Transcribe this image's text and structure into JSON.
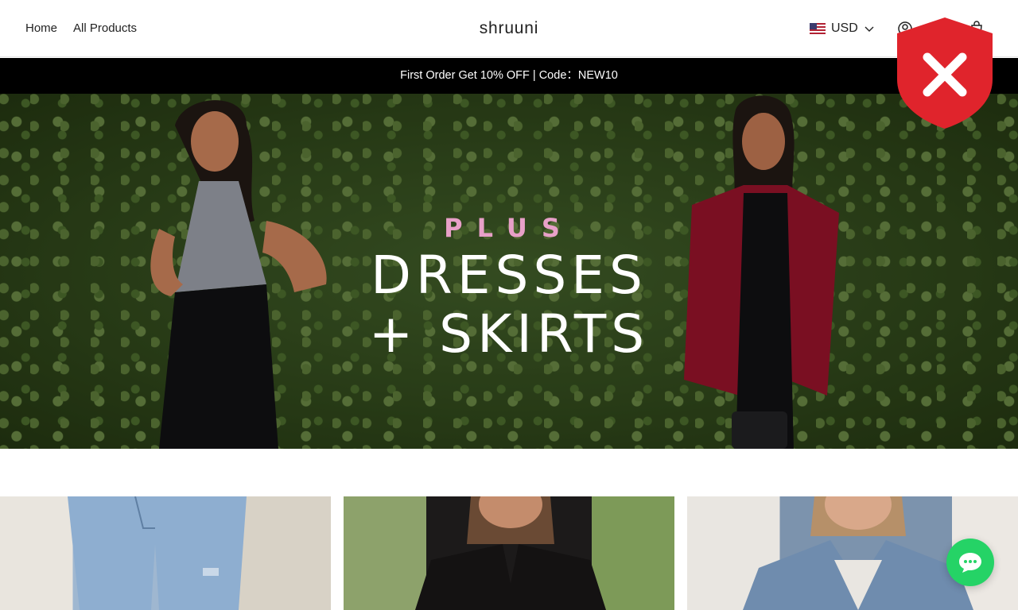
{
  "header": {
    "nav": [
      {
        "label": "Home"
      },
      {
        "label": "All Products"
      }
    ],
    "brand": "shruuni",
    "currency": {
      "code": "USD",
      "flag_icon": "us-flag-icon"
    },
    "icons": [
      "account-icon",
      "cart-icon"
    ]
  },
  "announcement": {
    "text": "First Order Get 10% OFF | Code：NEW10"
  },
  "hero": {
    "kicker": "PLUS",
    "line1": "DRESSES",
    "line2": "+ SKIRTS",
    "kicker_color": "#e8a0c8"
  },
  "overlay": {
    "security_badge_icon": "shield-x-icon",
    "badge_color": "#e0242c"
  },
  "chat": {
    "icon": "chat-bubble-icon",
    "color": "#25d366"
  }
}
